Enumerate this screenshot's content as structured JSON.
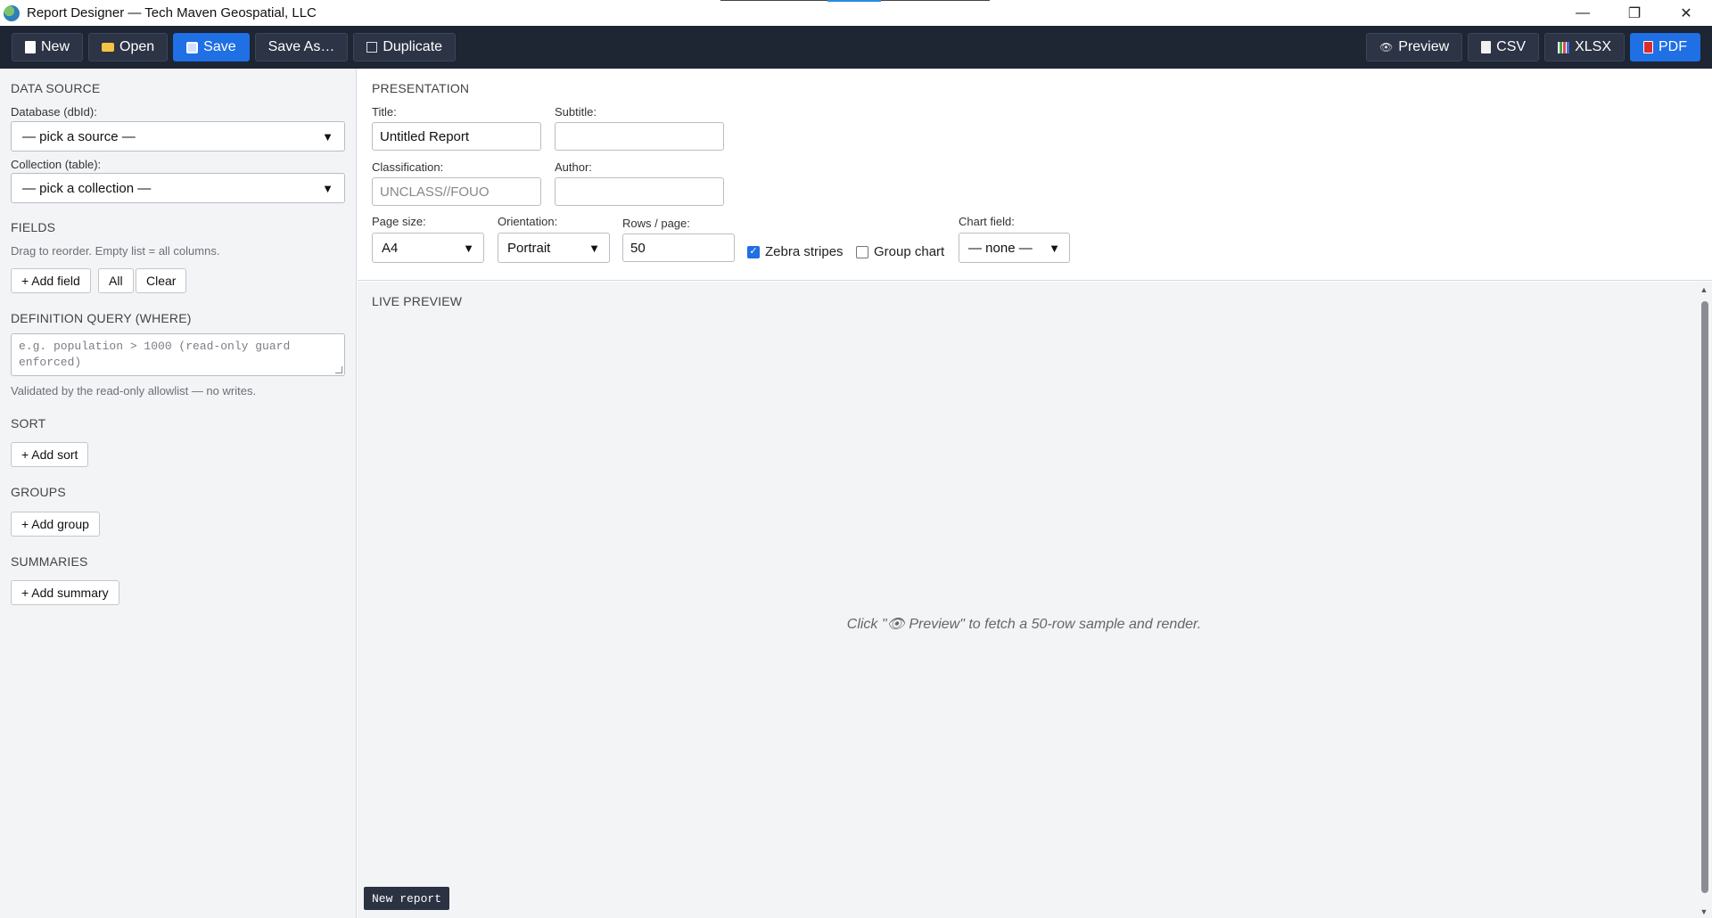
{
  "window": {
    "title": "Report Designer — Tech Maven Geospatial, LLC",
    "controls": {
      "minimize": "—",
      "maximize": "❐",
      "close": "✕"
    }
  },
  "toolbar": {
    "left": [
      {
        "label": "New",
        "icon": "document-icon"
      },
      {
        "label": "Open",
        "icon": "folder-icon"
      },
      {
        "label": "Save",
        "icon": "save-icon",
        "primary": true
      },
      {
        "label": "Save As…"
      },
      {
        "label": "Duplicate",
        "icon": "copy-icon"
      }
    ],
    "right": [
      {
        "label": "Preview",
        "icon": "eye-icon"
      },
      {
        "label": "CSV",
        "icon": "clipboard-icon"
      },
      {
        "label": "XLSX",
        "icon": "chart-icon"
      },
      {
        "label": "PDF",
        "icon": "pdf-icon",
        "primary": true
      }
    ]
  },
  "sidebar": {
    "data_source": {
      "heading": "DATA SOURCE",
      "database_label": "Database (dbId):",
      "database_value": "— pick a source —",
      "collection_label": "Collection (table):",
      "collection_value": "— pick a collection —"
    },
    "fields": {
      "heading": "FIELDS",
      "hint": "Drag to reorder. Empty list = all columns.",
      "add_label": "+ Add field",
      "all_label": "All",
      "clear_label": "Clear"
    },
    "definition_query": {
      "heading": "DEFINITION QUERY (WHERE)",
      "placeholder": "e.g. population > 1000 (read-only guard enforced)",
      "hint": "Validated by the read-only allowlist — no writes."
    },
    "sort": {
      "heading": "SORT",
      "add_label": "+ Add sort"
    },
    "groups": {
      "heading": "GROUPS",
      "add_label": "+ Add group"
    },
    "summaries": {
      "heading": "SUMMARIES",
      "add_label": "+ Add summary"
    }
  },
  "presentation": {
    "heading": "PRESENTATION",
    "title_label": "Title:",
    "title_value": "Untitled Report",
    "subtitle_label": "Subtitle:",
    "subtitle_value": "",
    "classification_label": "Classification:",
    "classification_placeholder": "UNCLASS//FOUO",
    "author_label": "Author:",
    "author_value": "",
    "page_size_label": "Page size:",
    "page_size_value": "A4",
    "orientation_label": "Orientation:",
    "orientation_value": "Portrait",
    "rows_label": "Rows / page:",
    "rows_value": "50",
    "zebra_label": "Zebra stripes",
    "zebra_checked": true,
    "group_chart_label": "Group chart",
    "group_chart_checked": false,
    "chart_field_label": "Chart field:",
    "chart_field_value": "— none —"
  },
  "live_preview": {
    "heading": "LIVE PREVIEW",
    "message": "Click \"👁 Preview\" to fetch a 50-row sample and render.",
    "status": "New report"
  }
}
